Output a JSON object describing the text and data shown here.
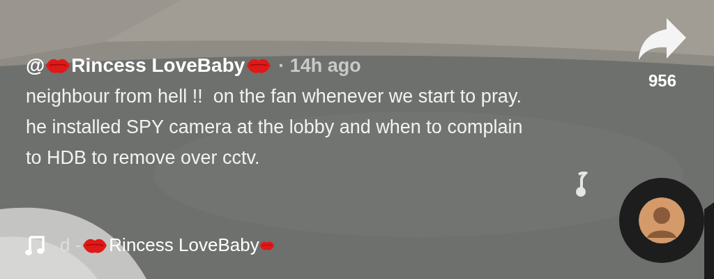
{
  "post": {
    "author_prefix": "@",
    "author": "Rincess LoveBaby",
    "time": "· 14h ago",
    "caption": "neighbour from hell !!  on the fan whenever we start to pray.  he installed SPY camera at the lobby and when to complain to HDB to remove over cctv.",
    "sound": {
      "prefix": "d -",
      "name": "Rincess LoveBaby"
    }
  },
  "actions": [
    {
      "kind": "share",
      "count": "956"
    }
  ]
}
